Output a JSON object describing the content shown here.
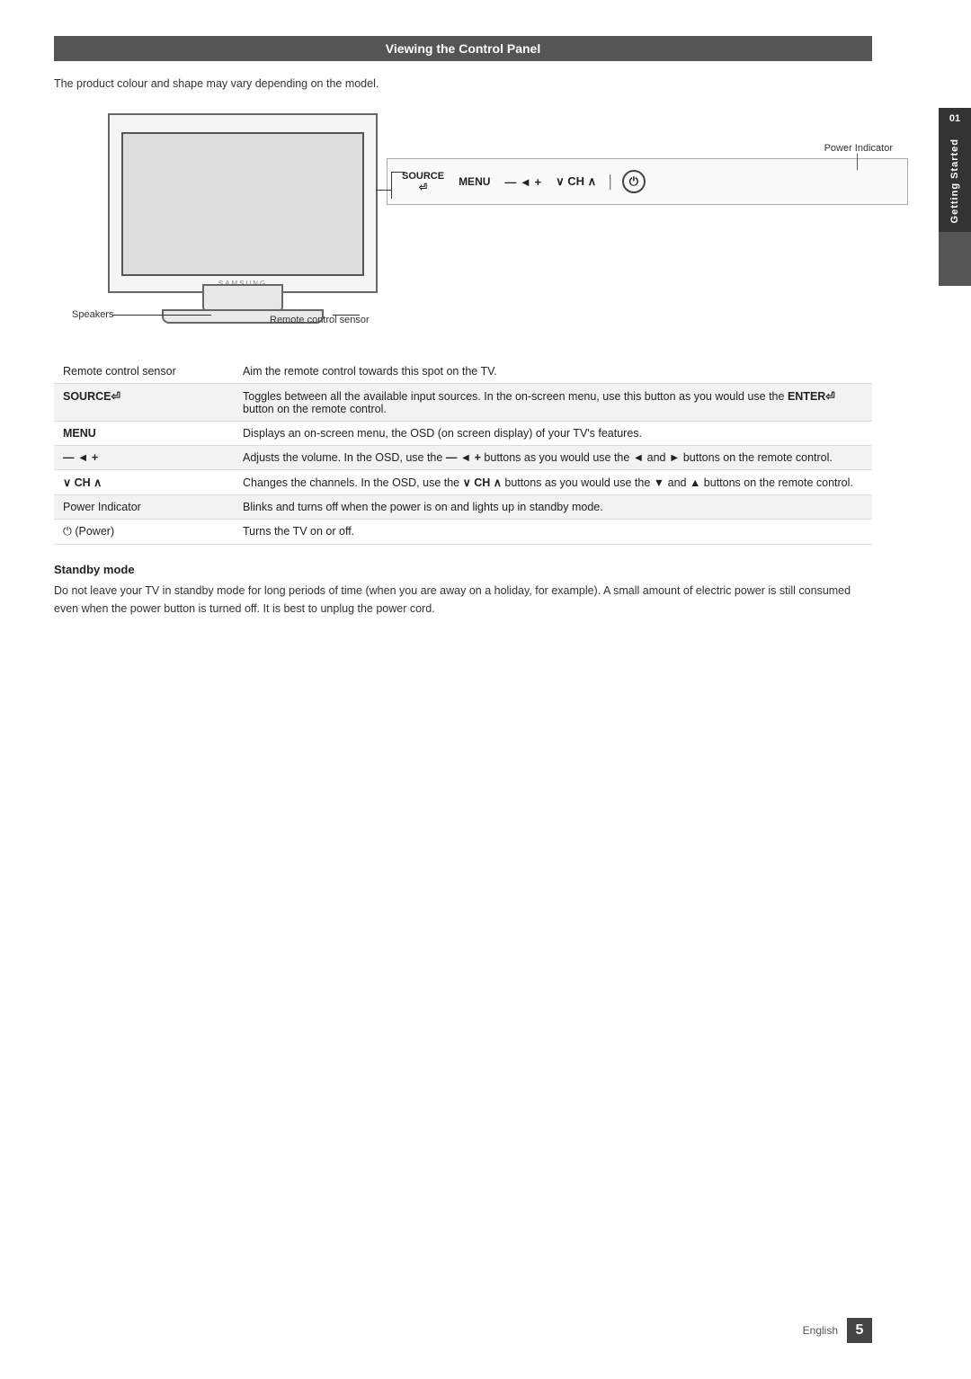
{
  "page": {
    "title": "Viewing the Control Panel",
    "subtitle": "The product colour and shape may vary depending on the model.",
    "side_tab": {
      "number": "01",
      "text": "Getting Started"
    },
    "footer": {
      "lang": "English",
      "page": "5"
    }
  },
  "diagram": {
    "brand": "SAMSUNG",
    "label_speakers": "Speakers",
    "label_remote_sensor": "Remote control sensor",
    "power_indicator_label": "Power Indicator",
    "controls": "SOURCE   MENU  — ◄ +  ∨ CH ∧  ⏻"
  },
  "table": {
    "rows": [
      {
        "term": "Remote control sensor",
        "definition": "Aim the remote control towards this spot on the TV.",
        "bold_term": false
      },
      {
        "term": "SOURCE⏎",
        "definition": "Toggles between all the available input sources. In the on-screen menu, use this button as you would use the ENTER⏎ button on the remote control.",
        "bold_term": true
      },
      {
        "term": "MENU",
        "definition": "Displays an on-screen menu, the OSD (on screen display) of your TV's features.",
        "bold_term": true
      },
      {
        "term": "— ◄ +",
        "definition": "Adjusts the volume. In the OSD, use the — ◄ + buttons as you would use the ◄ and ► buttons on the remote control.",
        "bold_term": true
      },
      {
        "term": "∨ CH ∧",
        "definition": "Changes the channels. In the OSD, use the ∨ CH ∧ buttons as you would use the ▼ and ▲ buttons on the remote control.",
        "bold_term": true
      },
      {
        "term": "Power Indicator",
        "definition": "Blinks and turns off when the power is on and lights up in standby mode.",
        "bold_term": false
      },
      {
        "term": "⏻ (Power)",
        "definition": "Turns the TV on or off.",
        "bold_term": false
      }
    ]
  },
  "standby": {
    "title": "Standby mode",
    "text": "Do not leave your TV in standby mode for long periods of time (when you are away on a holiday, for example). A small amount of electric power is still consumed even when the power button is turned off. It is best to unplug the power cord."
  }
}
